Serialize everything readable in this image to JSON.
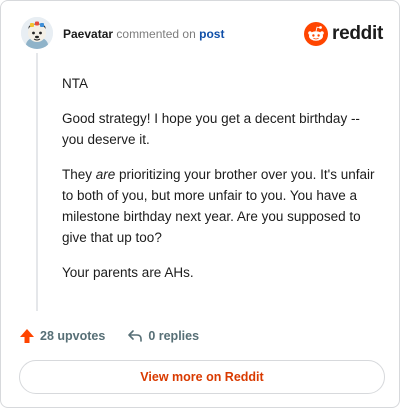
{
  "header": {
    "username": "Paevatar",
    "verb": "commented on",
    "post_link": "post",
    "brand": "reddit",
    "brand_color": "#ff4500"
  },
  "comment": {
    "p1": "NTA",
    "p2": "Good strategy! I hope you get a decent birthday -- you deserve it.",
    "p3_before": "They ",
    "p3_emphasis": "are",
    "p3_after": " prioritizing your brother over you. It's unfair to both of you, but more unfair to you. You have a milestone birthday next year. Are you supposed to give that up too?",
    "p4": "Your parents are AHs."
  },
  "footer": {
    "upvotes_label": "28 upvotes",
    "replies_label": "0 replies",
    "upvote_icon": "upvote-arrow-icon",
    "reply_icon": "reply-icon"
  },
  "cta": {
    "label": "View more on Reddit",
    "color": "#d93a00"
  }
}
